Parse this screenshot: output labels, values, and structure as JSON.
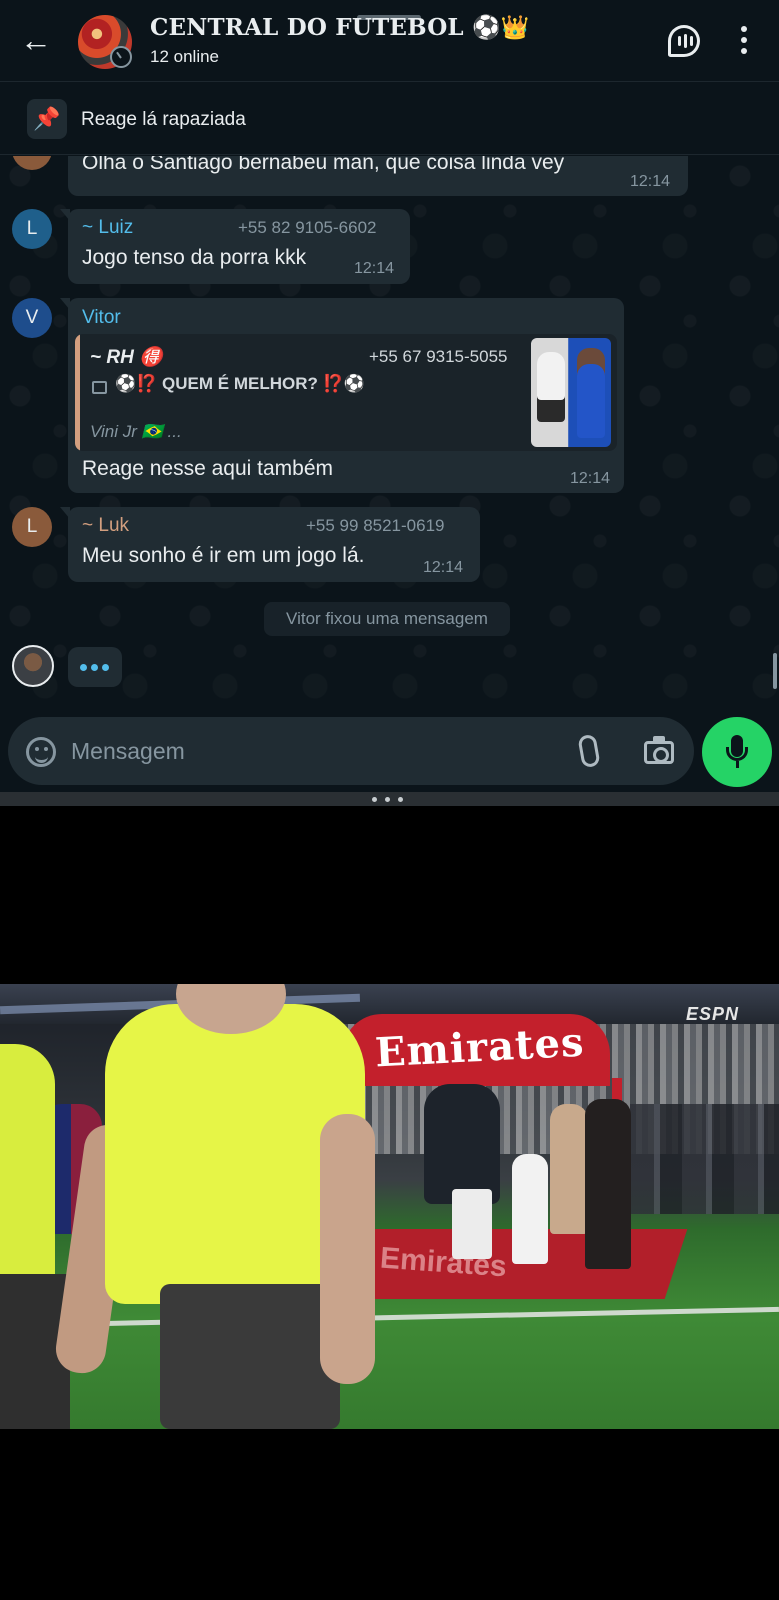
{
  "header": {
    "back_icon": "arrow-left-icon",
    "title": "CENTRAL DO FUTEBOL ⚽👑",
    "subtitle": "12 online",
    "voice_chat_icon": "voice-chat-icon",
    "menu_icon": "more-vert-icon"
  },
  "pinned": {
    "icon": "pin-icon",
    "text": "Reage lá rapaziada"
  },
  "messages": [
    {
      "text": "Olha o Santiago bernabeu man, que coisa linda vey",
      "time": "12:14"
    },
    {
      "avatar_letter": "L",
      "sender": "~ Luiz",
      "sender_color": "#53bdeb",
      "phone": "+55 82 9105-6602",
      "text": "Jogo tenso da porra kkk",
      "time": "12:14"
    },
    {
      "avatar_letter": "V",
      "sender": "Vitor",
      "sender_color": "#53bdeb",
      "quote": {
        "sender": "~ RH 🉐",
        "phone": "+55 67 9315-5055",
        "text": "⚽⁉️ QUEM É MELHOR? ⁉️⚽",
        "caption": "Vini Jr 🇧🇷 ...",
        "accent_color": "#d39f7f"
      },
      "text": "Reage nesse aqui também",
      "time": "12:14"
    },
    {
      "avatar_letter": "L",
      "sender": "~ Luk",
      "sender_color": "#d39f7f",
      "phone": "+55 99 8521-0619",
      "text": "Meu sonho é ir em um jogo lá.",
      "time": "12:14"
    }
  ],
  "system_message": "Vitor fixou uma mensagem",
  "typing": {
    "icon": "typing-dots-icon",
    "dot_color": "#53bdeb"
  },
  "composer": {
    "placeholder": "Mensagem",
    "emoji_icon": "sticker-icon",
    "attach_icon": "paperclip-icon",
    "camera_icon": "camera-icon",
    "mic_icon": "mic-icon",
    "mic_color": "#25d366"
  },
  "video": {
    "broadcaster": "ESPN",
    "sponsor": "Emirates",
    "carpet_text": "Emirates"
  },
  "colors": {
    "background": "#0b141a",
    "bubble": "#202c33",
    "text": "#e9edef",
    "muted": "#8696a0"
  }
}
